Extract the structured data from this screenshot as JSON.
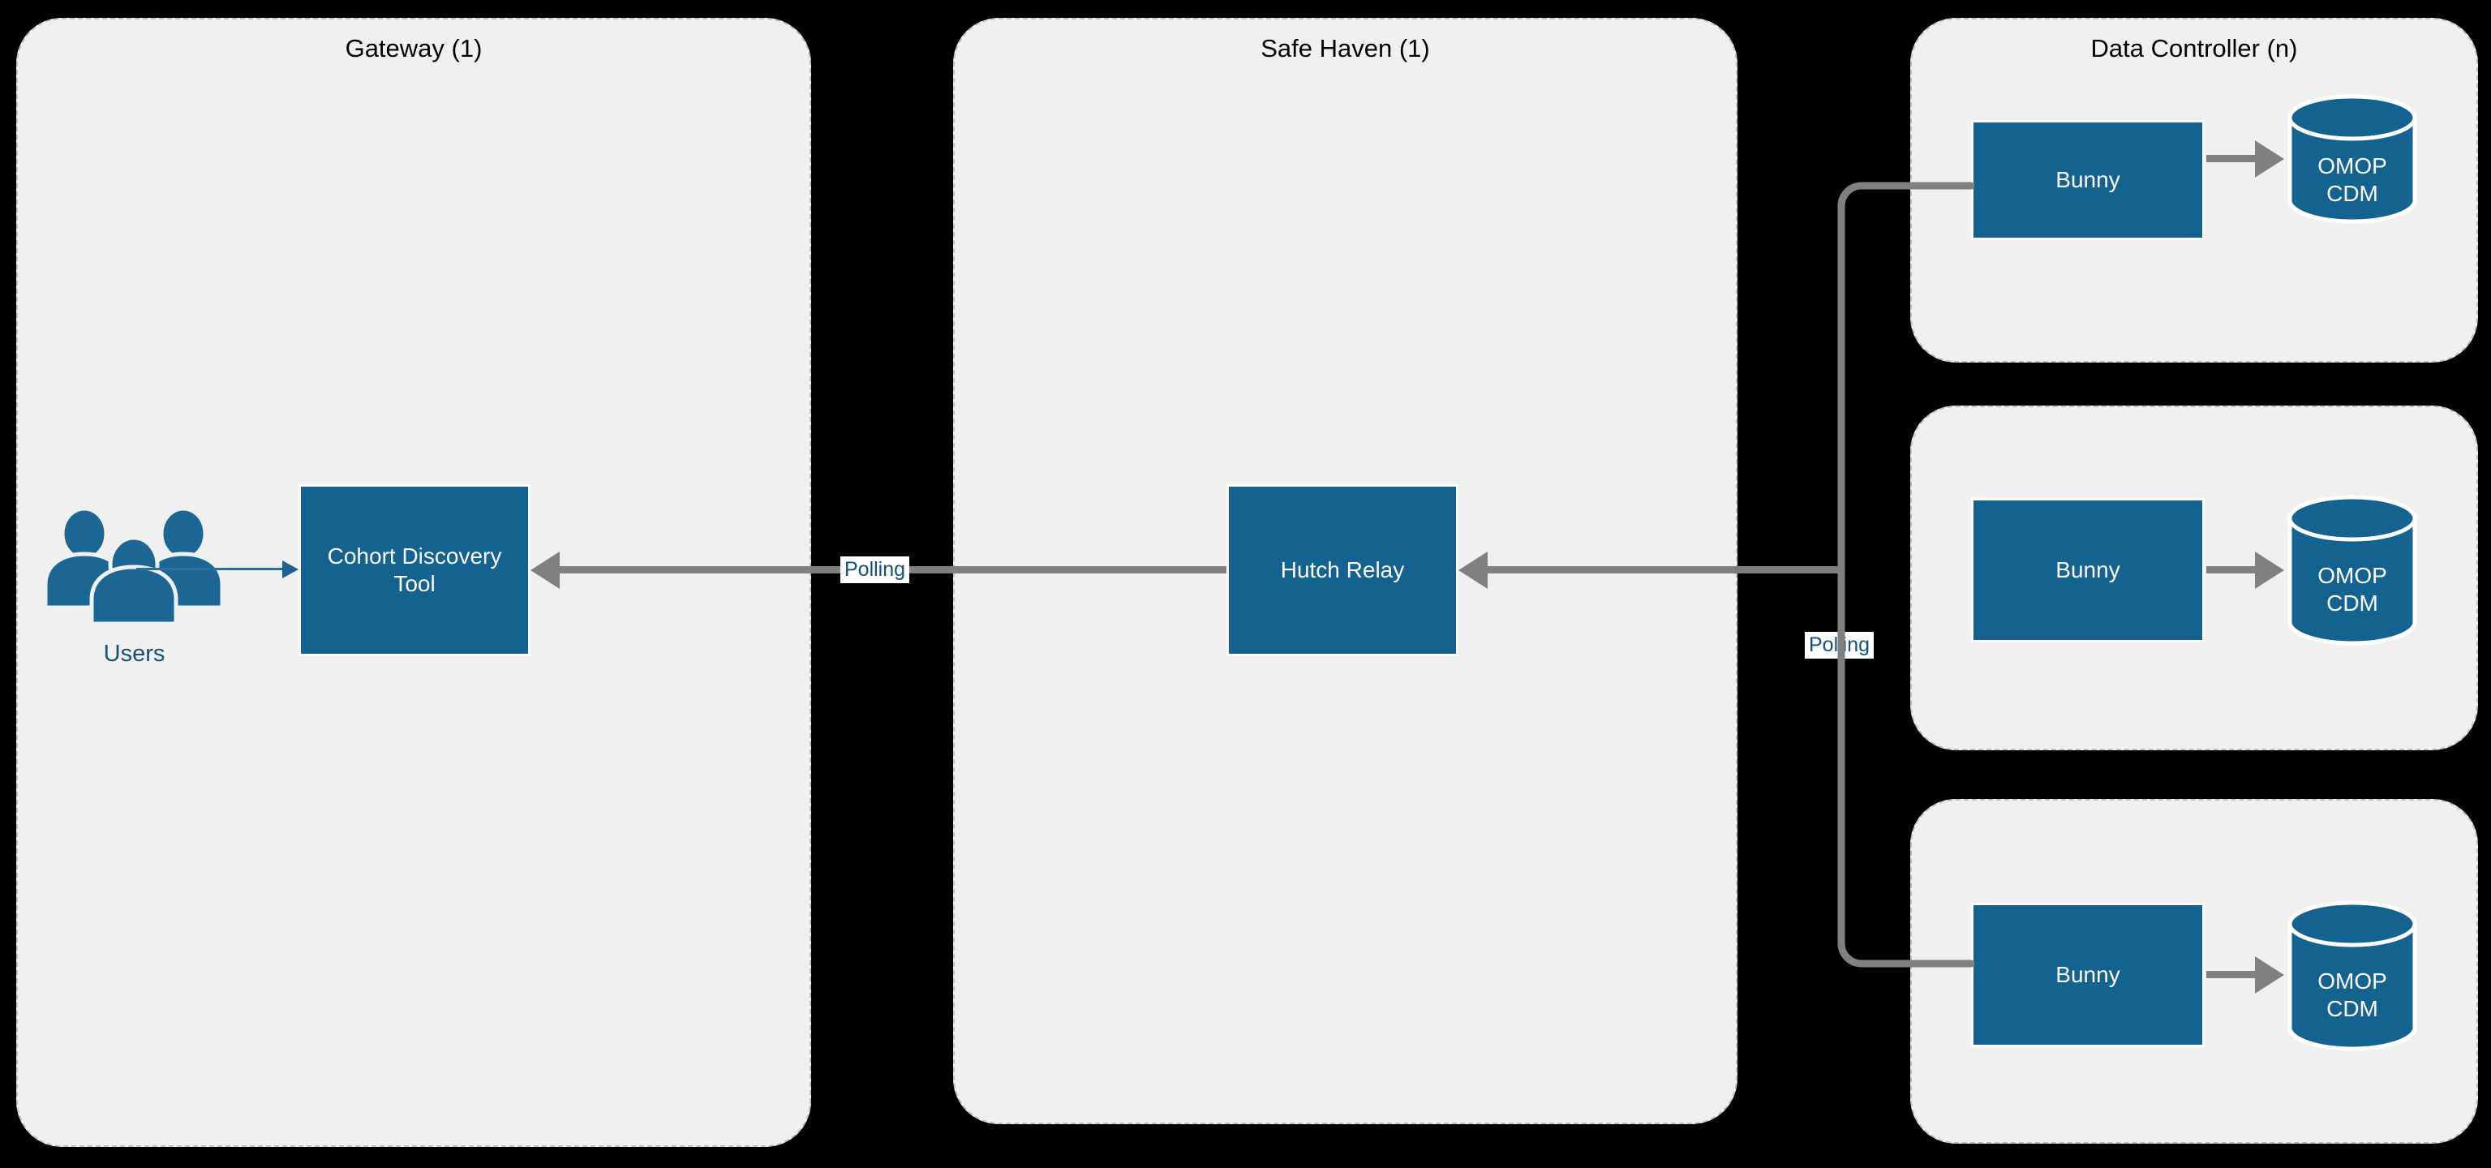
{
  "diagram": {
    "background_color": "#000000",
    "zone_fill": "#F0F0F0",
    "zone_border": "#BFBFBF",
    "node_fill": "#14628F",
    "node_text": "#FFFFFF",
    "connector_color": "#808080",
    "label_text_color": "#14527B",
    "title_text_color": "#000000"
  },
  "zones": [
    {
      "id": "gateway",
      "title": "Gateway (1)"
    },
    {
      "id": "safe_haven",
      "title": "Safe Haven (1)"
    },
    {
      "id": "data_ctrl_top",
      "title": "Data Controller (n)"
    },
    {
      "id": "data_ctrl_mid",
      "title": ""
    },
    {
      "id": "data_ctrl_bot",
      "title": ""
    }
  ],
  "nodes": {
    "users": {
      "label": "Users",
      "icon": "users-icon"
    },
    "cohort_discovery_tool": {
      "label": "Cohort Discovery Tool"
    },
    "hutch_relay": {
      "label": "Hutch Relay"
    },
    "bunny_top": {
      "label": "Bunny"
    },
    "bunny_mid": {
      "label": "Bunny"
    },
    "bunny_bot": {
      "label": "Bunny"
    },
    "omop_top": {
      "label": "OMOP CDM",
      "line1": "OMOP",
      "line2": "CDM",
      "icon": "database-cylinder-icon"
    },
    "omop_mid": {
      "label": "OMOP CDM",
      "line1": "OMOP",
      "line2": "CDM",
      "icon": "database-cylinder-icon"
    },
    "omop_bot": {
      "label": "OMOP CDM",
      "line1": "OMOP",
      "line2": "CDM",
      "icon": "database-cylinder-icon"
    }
  },
  "edges": {
    "users_to_cdt": {
      "label": ""
    },
    "relay_to_cdt": {
      "label": "Polling"
    },
    "bunny_to_relay": {
      "label": "Polling"
    },
    "bunny_to_omop_top": {
      "label": ""
    },
    "bunny_to_omop_mid": {
      "label": ""
    },
    "bunny_to_omop_bot": {
      "label": ""
    }
  }
}
